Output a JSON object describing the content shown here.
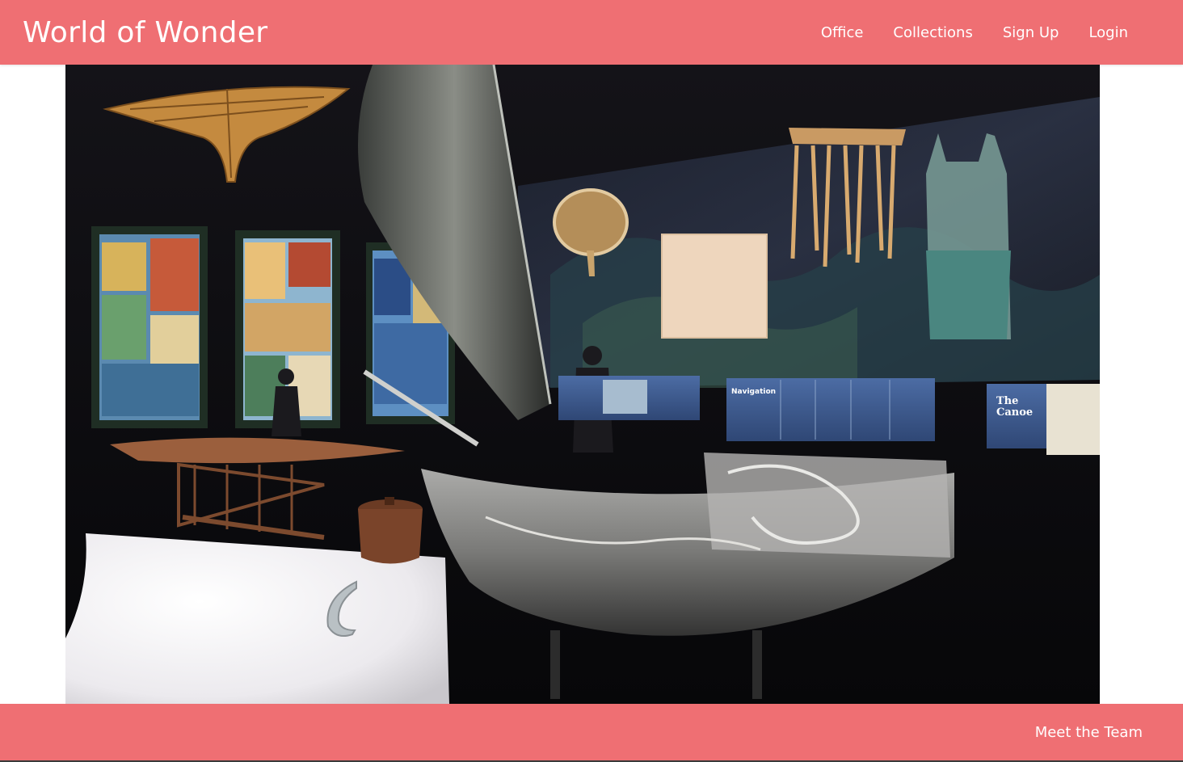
{
  "header": {
    "brand": "World of Wonder",
    "nav": {
      "office": "Office",
      "collections": "Collections",
      "signup": "Sign Up",
      "login": "Login"
    }
  },
  "footer": {
    "meet_team": "Meet the Team"
  },
  "hero": {
    "panels": {
      "navigation_title": "Navigation",
      "canoe_title_line1": "The",
      "canoe_title_line2": "Canoe"
    }
  },
  "colors": {
    "brand_pink": "#ef6f73",
    "text_white": "#ffffff"
  }
}
